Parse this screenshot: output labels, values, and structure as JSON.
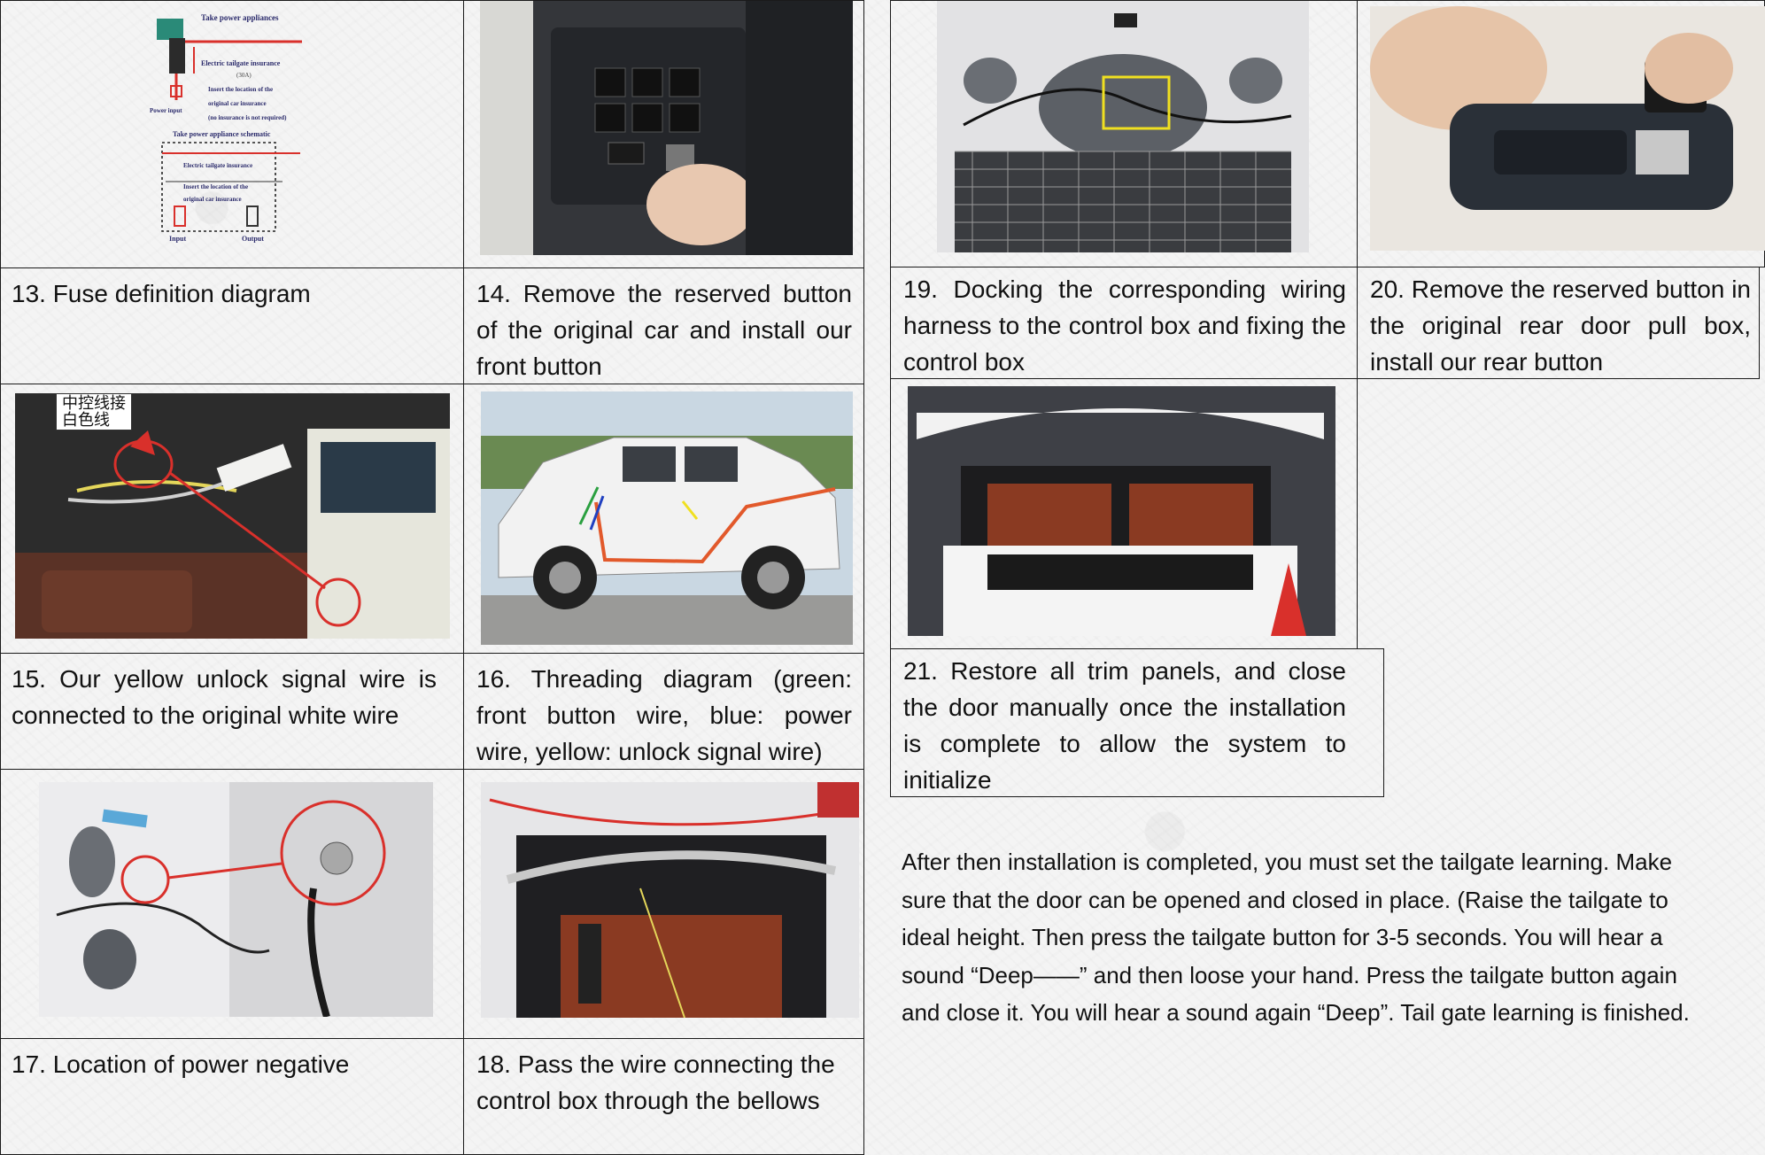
{
  "steps": [
    {
      "id": 13,
      "caption": "13. Fuse definition diagram"
    },
    {
      "id": 14,
      "caption": "14. Remove the reserved button of the original car and install our front button"
    },
    {
      "id": 15,
      "caption": "15. Our yellow unlock signal wire is connected to the original white wire"
    },
    {
      "id": 16,
      "caption": "16. Threading diagram (green: front button wire, blue: power wire, yellow: unlock signal wire)"
    },
    {
      "id": 17,
      "caption": "17. Location of power negative"
    },
    {
      "id": 18,
      "caption": "18. Pass the wire connecting the control box through the bellows"
    },
    {
      "id": 19,
      "caption": "19. Docking the corresponding wiring harness to the control box and fixing the control box"
    },
    {
      "id": 20,
      "caption": "20. Remove the reserved button in the original rear door pull box, install our rear button"
    },
    {
      "id": 21,
      "caption": "21. Restore all trim panels, and close the door manually once the installation is complete to allow the system to initialize"
    }
  ],
  "fuse_diagram": {
    "title": "Take power appliances",
    "tailgate_insurance": "Electric tailgate insurance",
    "amps": "(30A)",
    "insert_note_1": "Insert the location of the",
    "insert_note_2": "original car insurance",
    "insert_note_3": "(no insurance is not required)",
    "power_input": "Power input",
    "schematic_title": "Take power appliance schematic",
    "inner_insurance": "Electric tailgate insurance",
    "inner_insert_1": "Insert the location of the",
    "inner_insert_2": "original car insurance",
    "input": "Input",
    "output": "Output"
  },
  "photo_label": {
    "line1": "中控线接",
    "line2": "白色线"
  },
  "note": "After then installation is completed, you must set the tailgate learning. Make\nsure that the door can be opened and closed in place. (Raise the tailgate to\nideal height. Then press the tailgate button for 3-5 seconds. You will hear a\nsound “Deep——” and then loose your hand. Press the tailgate button again\nand close it. You will hear a sound again “Deep”. Tail gate learning is finished.",
  "colors": {
    "border": "#1a1a1a",
    "highlight_red": "#d9302b",
    "wire_orange": "#e2592b",
    "marker_yellow": "#f0e020"
  }
}
